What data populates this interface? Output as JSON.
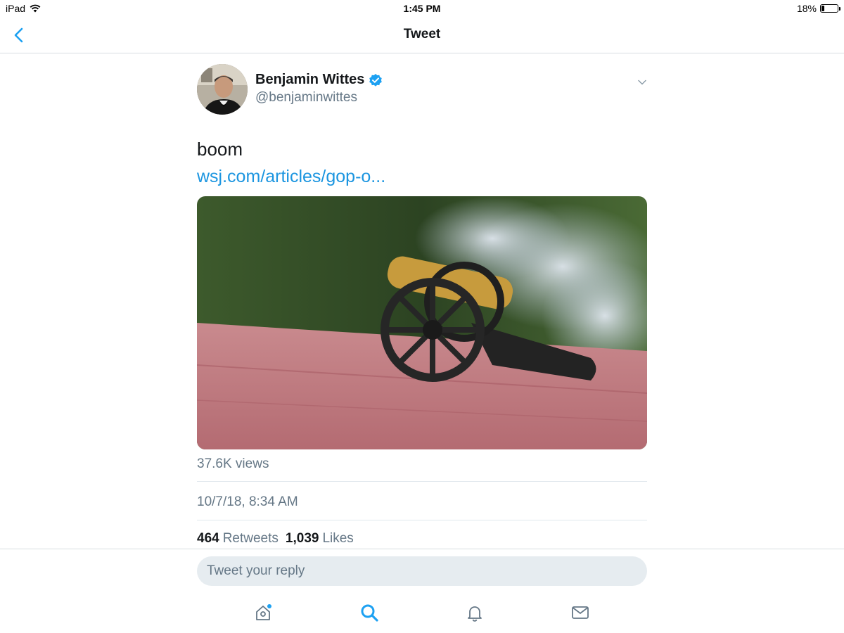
{
  "status_bar": {
    "device": "iPad",
    "time": "1:45 PM",
    "battery_percent": "18%",
    "battery_level": 0.18
  },
  "nav": {
    "title": "Tweet",
    "back_icon": "chevron-left-icon"
  },
  "tweet": {
    "author_name": "Benjamin Wittes",
    "author_handle": "@benjaminwittes",
    "verified": true,
    "text": "boom",
    "link": "wsj.com/articles/gop-o...",
    "views": "37.6K views",
    "timestamp": "10/7/18, 8:34 AM",
    "retweets": "464",
    "retweets_label": "Retweets",
    "likes": "1,039",
    "likes_label": "Likes"
  },
  "reply": {
    "placeholder": "Tweet your reply"
  },
  "tabbar": {
    "items": [
      "home-icon",
      "search-icon",
      "notifications-icon",
      "messages-icon"
    ],
    "active": "search-icon"
  },
  "colors": {
    "accent": "#1da1f2",
    "link": "#1b95e0",
    "secondary_text": "#657786",
    "reply_bg": "#e6ecf0"
  }
}
